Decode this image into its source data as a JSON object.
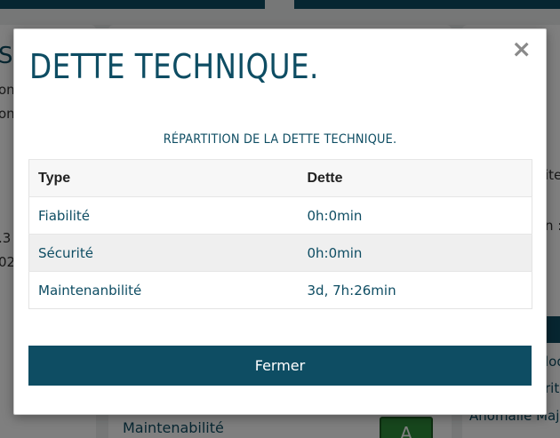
{
  "background": {
    "left_fragments": [
      "S",
      "on",
      "on",
      ".3",
      "02"
    ],
    "right_fragments": [
      "ite",
      "n :",
      "lod",
      "rit",
      "Anomalie Maj"
    ],
    "bottom_label": "Maintenabilité",
    "badge": "A"
  },
  "modal": {
    "title": "DETTE TECHNIQUE.",
    "close_label": "×",
    "section_title": "RÉPARTITION DE LA DETTE TECHNIQUE.",
    "table": {
      "headers": [
        "Type",
        "Dette"
      ],
      "rows": [
        {
          "type": "Fiabilité",
          "debt": "0h:0min"
        },
        {
          "type": "Sécurité",
          "debt": "0h:0min"
        },
        {
          "type": "Maintenanbilité",
          "debt": "3d, 7h:26min"
        }
      ]
    },
    "close_button": "Fermer"
  },
  "colors": {
    "accent": "#0e4d63",
    "badge_green": "#2f8f3a"
  }
}
